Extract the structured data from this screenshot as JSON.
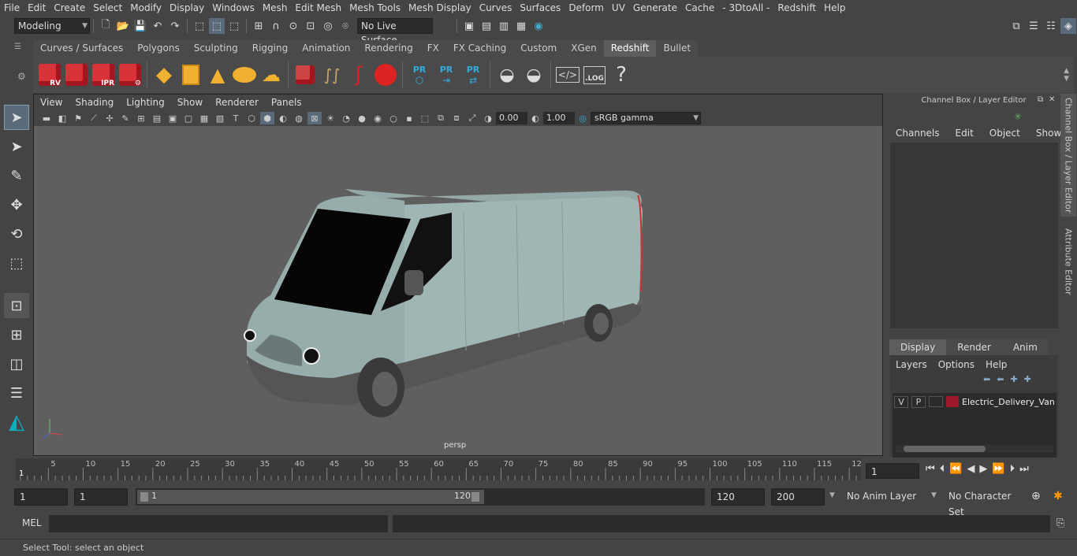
{
  "menu": [
    "File",
    "Edit",
    "Create",
    "Select",
    "Modify",
    "Display",
    "Windows",
    "Mesh",
    "Edit Mesh",
    "Mesh Tools",
    "Mesh Display",
    "Curves",
    "Surfaces",
    "Deform",
    "UV",
    "Generate",
    "Cache",
    "- 3DtoAll -",
    "Redshift",
    "Help"
  ],
  "workspace": "Modeling",
  "live_surface": "No Live Surface",
  "shelf_tabs": [
    "Curves / Surfaces",
    "Polygons",
    "Sculpting",
    "Rigging",
    "Animation",
    "Rendering",
    "FX",
    "FX Caching",
    "Custom",
    "XGen",
    "Redshift",
    "Bullet"
  ],
  "shelf_active": "Redshift",
  "shelf_labels": {
    "rv": "RV",
    "ipr": "IPR",
    "pr1": "PR",
    "pr2": "PR",
    "pr3": "PR",
    "log": ".LOG",
    "help": "?"
  },
  "viewport": {
    "menu": [
      "View",
      "Shading",
      "Lighting",
      "Show",
      "Renderer",
      "Panels"
    ],
    "exposure": "0.00",
    "gamma": "1.00",
    "colorspace": "sRGB gamma",
    "camera": "persp"
  },
  "channel_box": {
    "title": "Channel Box / Layer Editor",
    "menu": [
      "Channels",
      "Edit",
      "Object",
      "Show"
    ],
    "tabs": [
      "Display",
      "Render",
      "Anim"
    ],
    "active_tab": "Display",
    "layer_menu": [
      "Layers",
      "Options",
      "Help"
    ],
    "layer": {
      "v": "V",
      "p": "P",
      "name": "Electric_Delivery_Van",
      "color": "#a0182c"
    }
  },
  "side_tabs": [
    "Channel Box / Layer Editor",
    "Attribute Editor"
  ],
  "timeline": {
    "ticks": [
      "5",
      "10",
      "15",
      "20",
      "25",
      "30",
      "35",
      "40",
      "45",
      "50",
      "55",
      "60",
      "65",
      "70",
      "75",
      "80",
      "85",
      "90",
      "95",
      "100",
      "105",
      "110",
      "115",
      "12"
    ],
    "start_marker": "1",
    "current_frame": "1"
  },
  "range": {
    "start": "1",
    "start2": "1",
    "slider_start": "1",
    "slider_end": "120",
    "end": "120",
    "end2": "200",
    "anim_layer": "No Anim Layer",
    "char_set": "No Character Set"
  },
  "mel": {
    "label": "MEL"
  },
  "status": "Select Tool: select an object"
}
